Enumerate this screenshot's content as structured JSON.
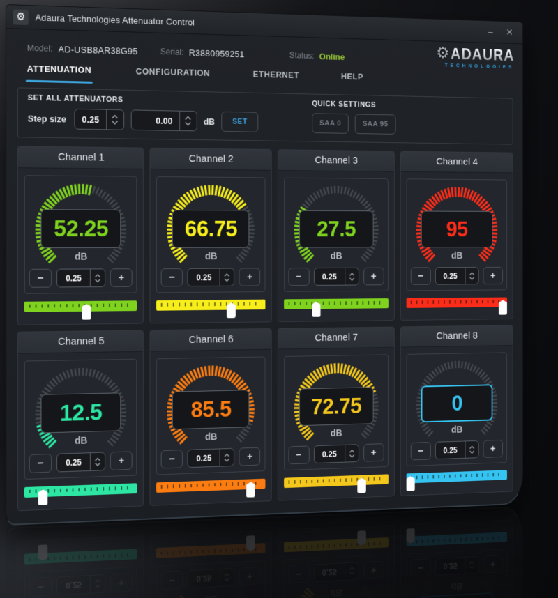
{
  "icons": {
    "titlebar_gear": "⚙",
    "logo_gear": "⚙",
    "minimize": "–",
    "close": "✕"
  },
  "titlebar": {
    "title": "Adaura Technologies Attenuator Control"
  },
  "header": {
    "model_label": "Model:",
    "model_value": "AD-USB8AR38G95",
    "serial_label": "Serial:",
    "serial_value": "R3880959251",
    "status_label": "Status:",
    "status_value": "Online",
    "status_color": "#94c335",
    "logo_text": "ADAURA",
    "logo_subtext": "TECHNOLOGIES",
    "logo_accent": "#2f9fdc"
  },
  "tabs": [
    {
      "label": "ATTENUATION",
      "active": true
    },
    {
      "label": "CONFIGURATION",
      "active": false
    },
    {
      "label": "ETHERNET",
      "active": false
    },
    {
      "label": "HELP",
      "active": false
    }
  ],
  "set_all": {
    "heading": "SET ALL ATTENUATORS",
    "step_label": "Step size",
    "step_value": "0.25",
    "value": "0.00",
    "unit": "dB",
    "set_button": "SET"
  },
  "quick_settings": {
    "heading": "QUICK SETTINGS",
    "buttons": [
      "SAA 0",
      "SAA 95"
    ]
  },
  "channels": {
    "unit": "dB",
    "step_value": "0.25",
    "min": 0,
    "max": 95,
    "gray_tick_color": "#43484e",
    "accent_active_border": "#35c4f2",
    "items": [
      {
        "label": "Channel 1",
        "value": 52.25,
        "display": "52.25",
        "color": "#7fd31f",
        "focused": false
      },
      {
        "label": "Channel 2",
        "value": 66.75,
        "display": "66.75",
        "color": "#f7ee1b",
        "focused": false
      },
      {
        "label": "Channel 3",
        "value": 27.5,
        "display": "27.5",
        "color": "#7fd31f",
        "focused": false
      },
      {
        "label": "Channel 4",
        "value": 95,
        "display": "95",
        "color": "#fb2d1a",
        "focused": false
      },
      {
        "label": "Channel 5",
        "value": 12.5,
        "display": "12.5",
        "color": "#2de6a3",
        "focused": false
      },
      {
        "label": "Channel 6",
        "value": 85.5,
        "display": "85.5",
        "color": "#fb7d11",
        "focused": false
      },
      {
        "label": "Channel 7",
        "value": 72.75,
        "display": "72.75",
        "color": "#f3c71b",
        "focused": false
      },
      {
        "label": "Channel 8",
        "value": 0,
        "display": "0",
        "color": "#35c4f2",
        "focused": true
      }
    ]
  }
}
